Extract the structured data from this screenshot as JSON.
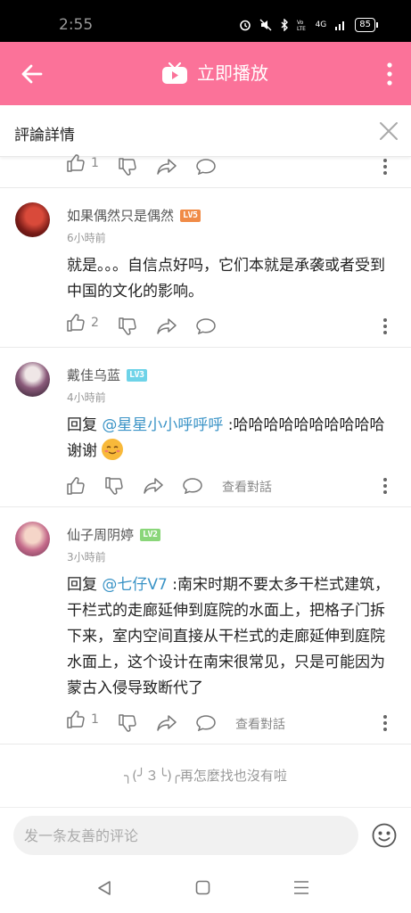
{
  "status_bar": {
    "time": "2:55",
    "network": "4G",
    "battery": "85"
  },
  "app_bar": {
    "title": "立即播放"
  },
  "subheader": {
    "title": "評論詳情"
  },
  "top_actions": {
    "like_count": "1"
  },
  "comments": [
    {
      "username": "如果偶然只是偶然",
      "level": "LV5",
      "time": "6小時前",
      "text": "就是。。。自信点好吗，它们本就是承袭或者受到中国的文化的影响。",
      "like_count": "2"
    },
    {
      "username": "戴佳乌蓝",
      "level": "LV3",
      "time": "4小時前",
      "reply_prefix": "回复 ",
      "mention": "@星星小小呼呼呼",
      "text": " :哈哈哈哈哈哈哈哈哈哈谢谢",
      "emoji": "smile-emoji",
      "view_conversation": "查看對話"
    },
    {
      "username": "仙子周阴婷",
      "level": "LV2",
      "time": "3小時前",
      "reply_prefix": "回复 ",
      "mention": "@七仔V7",
      "text": " :南宋时期不要太多干栏式建筑，干栏式的走廊延伸到庭院的水面上，把格子门拆下来，室内空间直接从干栏式的走廊延伸到庭院水面上，这个设计在南宋很常见，只是可能因为蒙古入侵导致断代了",
      "like_count": "1",
      "view_conversation": "查看對話"
    }
  ],
  "end_message": "╮(╯３╰)╭再怎麼找也沒有啦",
  "comment_input": {
    "placeholder": "发一条友善的评论",
    "value": ""
  },
  "colors": {
    "accent": "#fb7299",
    "mention": "#3a93c6",
    "lv5": "#f08b47",
    "lv3": "#6ed3e8",
    "lv2": "#8ad67a"
  }
}
